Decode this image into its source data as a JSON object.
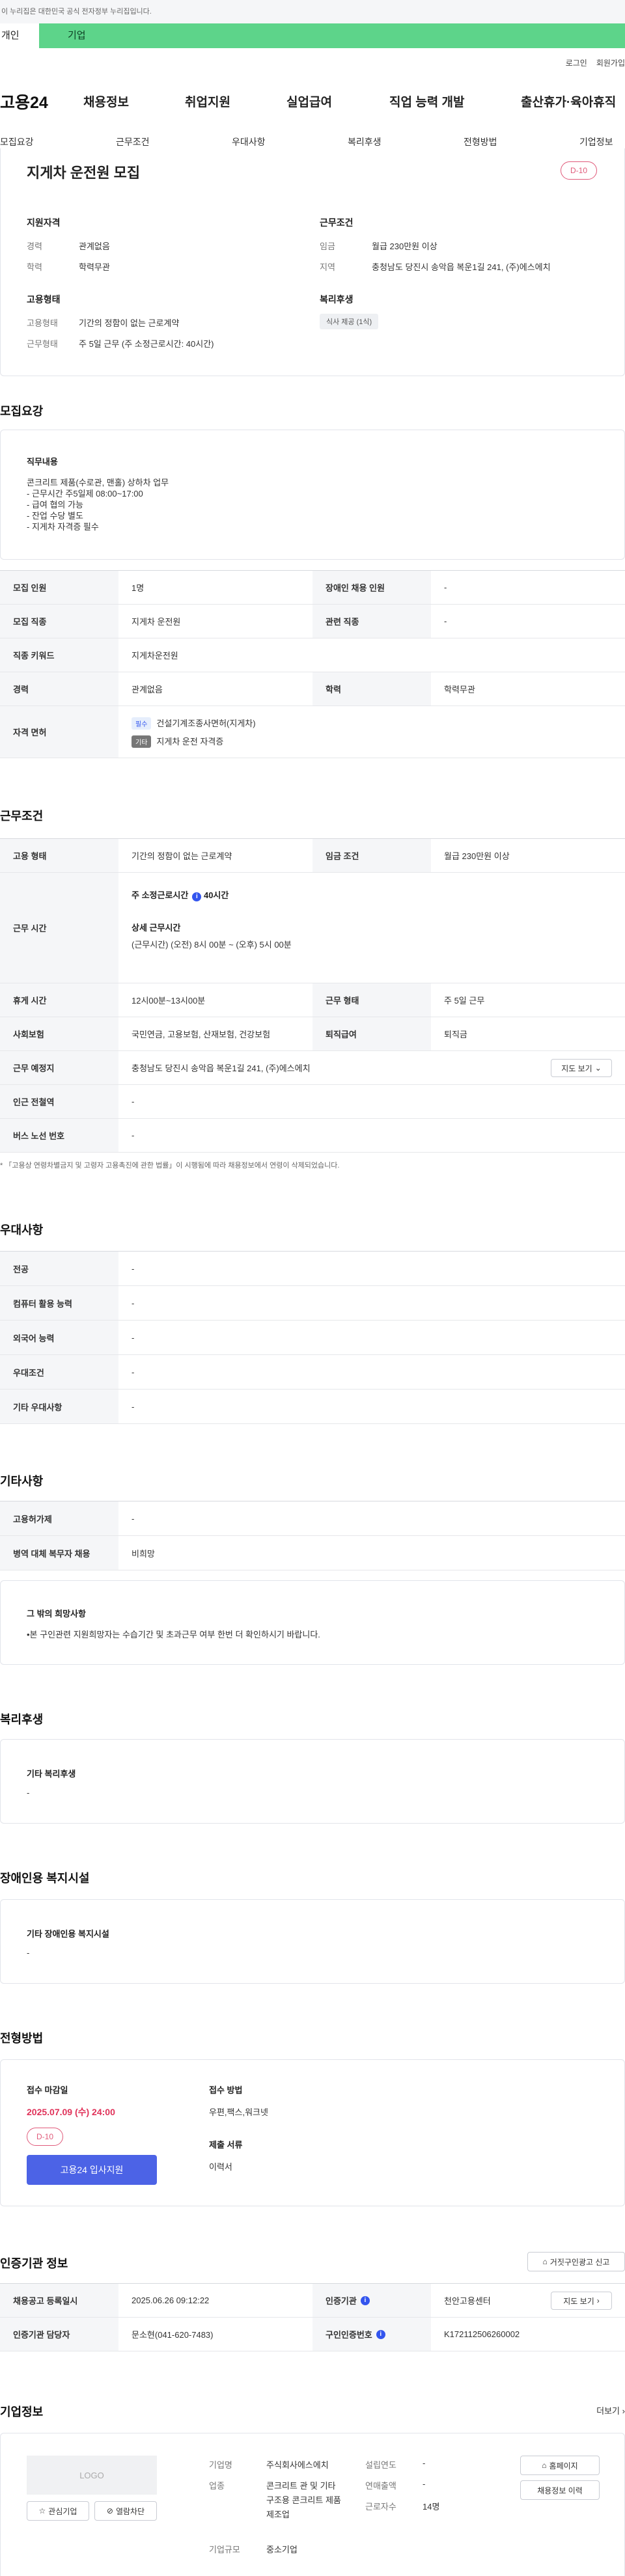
{
  "gov_notice": "이 누리집은 대한민국 공식 전자정부 누리집입니다.",
  "top_tabs": {
    "individual": "개인",
    "business": "기업"
  },
  "util": {
    "login": "로그인",
    "join": "회원가입"
  },
  "gnb": {
    "logo": "고용24",
    "menu": [
      "채용정보",
      "취업지원",
      "실업급여",
      "직업 능력 개발",
      "출산휴가·육아휴직"
    ]
  },
  "lnb": [
    "모집요강",
    "근무조건",
    "우대사항",
    "복리후생",
    "전형방법",
    "기업정보"
  ],
  "summary": {
    "title": "지게차 운전원 모집",
    "dday": "D-10",
    "req_title": "지원자격",
    "career_label": "경력",
    "career": "관계없음",
    "edu_label": "학력",
    "edu": "학력무관",
    "cond_title": "근무조건",
    "wage_label": "임금",
    "wage": "월급 230만원 이상",
    "area_label": "지역",
    "area": "충청남도 당진시 송악읍 복운1길 241, (주)에스에치",
    "emp_title": "고용형태",
    "emp_label": "고용형태",
    "emp": "기간의 정함이 없는 근로계약",
    "work_label": "근무형태",
    "work": "주 5일 근무 (주 소정근로시간: 40시간)",
    "welfare_title": "복리후생",
    "welfare_tag": "식사 제공 (1식)"
  },
  "recruit": {
    "heading": "모집요강",
    "duty_title": "직무내용",
    "duty_lines": [
      "콘크리트 제품(수로관, 맨홀) 상하차 업무",
      "- 근무시간 주5일제 08:00~17:00",
      "- 급여 협의 가능",
      "- 잔업 수당 별도",
      "- 지게차 자격증 필수"
    ],
    "rows": {
      "count_l": "모집 인원",
      "count": "1명",
      "disabled_l": "장애인 채용 인원",
      "disabled": "-",
      "job_l": "모집 직종",
      "job": "지게차 운전원",
      "related_l": "관련 직종",
      "related": "-",
      "kw_l": "직종 키워드",
      "kw": "지게차운전원",
      "career_l": "경력",
      "career": "관계없음",
      "edu_l": "학력",
      "edu": "학력무관",
      "license_l": "자격 면허",
      "lic1_badge": "필수",
      "lic1": "건설기계조종사면허(지게차)",
      "lic2_badge": "기타",
      "lic2": "지게차 운전 자격증"
    }
  },
  "conditions": {
    "heading": "근무조건",
    "emp_l": "고용 형태",
    "emp": "기간의 정함이 없는 근로계약",
    "wage_l": "임금 조건",
    "wage": "월급 230만원 이상",
    "time_l": "근무 시간",
    "time_main": "주 소정근로시간",
    "time_main_val": "40시간",
    "time_detail_title": "상세 근무시간",
    "time_detail": "(근무시간) (오전) 8시 00분 ~ (오후) 5시 00분",
    "rest_l": "휴게 시간",
    "rest": "12시00분~13시00분",
    "form_l": "근무 형태",
    "form": "주 5일 근무",
    "ins_l": "사회보험",
    "ins": "국민연금, 고용보험, 산재보험, 건강보험",
    "retire_l": "퇴직급여",
    "retire": "퇴직금",
    "place_l": "근무 예정지",
    "place": "충청남도 당진시 송악읍 복운1길 241, (주)에스에치",
    "map_btn": "지도 보기",
    "subway_l": "인근 전철역",
    "subway": "-",
    "bus_l": "버스 노선 번호",
    "bus": "-",
    "note": "* 「고용상 연령차별금지 및 고령자 고용촉진에 관한 법률」이 시행됨에 따라 채용정보에서 연령이 삭제되었습니다."
  },
  "prefer": {
    "heading": "우대사항",
    "rows": [
      {
        "l": "전공",
        "v": "-"
      },
      {
        "l": "컴퓨터 활용 능력",
        "v": "-"
      },
      {
        "l": "외국어 능력",
        "v": "-"
      },
      {
        "l": "우대조건",
        "v": "-"
      },
      {
        "l": "기타 우대사항",
        "v": "-"
      }
    ]
  },
  "etc": {
    "heading": "기타사항",
    "rows": [
      {
        "l": "고용허가제",
        "v": "-"
      },
      {
        "l": "병역 대체 복무자 채용",
        "v": "비희망"
      }
    ],
    "hope_title": "그 밖의 희망사항",
    "hope": "•본 구인관련 지원희망자는 수습기간 및 초과근무 여부 한번 더 확인하시기 바랍니다."
  },
  "welfare": {
    "heading": "복리후생",
    "title": "기타 복리후생",
    "value": "-"
  },
  "disabled_fac": {
    "heading": "장애인용 복지시설",
    "title": "기타 장애인용 복지시설",
    "value": "-"
  },
  "process": {
    "heading": "전형방법",
    "deadline_title": "접수 마감일",
    "deadline": "2025.07.09 (수) 24:00",
    "dday": "D-10",
    "apply_btn": "고용24 입사지원",
    "method_title": "접수 방법",
    "method": "우편,팩스,워크넷",
    "docs_title": "제출 서류",
    "docs": "이력서"
  },
  "agency": {
    "heading": "인증기관 정보",
    "report_btn": "거짓구인광고 신고",
    "reg_l": "채용공고 등록일시",
    "reg": "2025.06.26 09:12:22",
    "org_l": "인증기관",
    "org": "천안고용센터",
    "map_btn": "지도 보기",
    "mgr_l": "인증기관 담당자",
    "mgr": "문소현(041-620-7483)",
    "num_l": "구인인증번호",
    "num": "K172112506260002"
  },
  "company": {
    "heading": "기업정보",
    "more": "더보기",
    "logo": "LOGO",
    "interest_btn": "관심기업",
    "block_btn": "열람차단",
    "name_l": "기업명",
    "name": "주식회사에스에치",
    "ind_l": "업종",
    "ind": "콘크리트 관 및 기타 구조용 콘크리트 제품 제조업",
    "size_l": "기업규모",
    "size": "중소기업",
    "year_l": "설립연도",
    "year": "-",
    "sales_l": "연매출액",
    "sales": "-",
    "emp_l": "근로자수",
    "emp": "14명",
    "home_btn": "홈페이지",
    "hist_btn": "채용정보 이력"
  },
  "colors": {
    "accent_green": "#5dd48a",
    "blue_btn": "#4c63e6",
    "pink": "#e05a7a",
    "info": "#3355ee"
  }
}
